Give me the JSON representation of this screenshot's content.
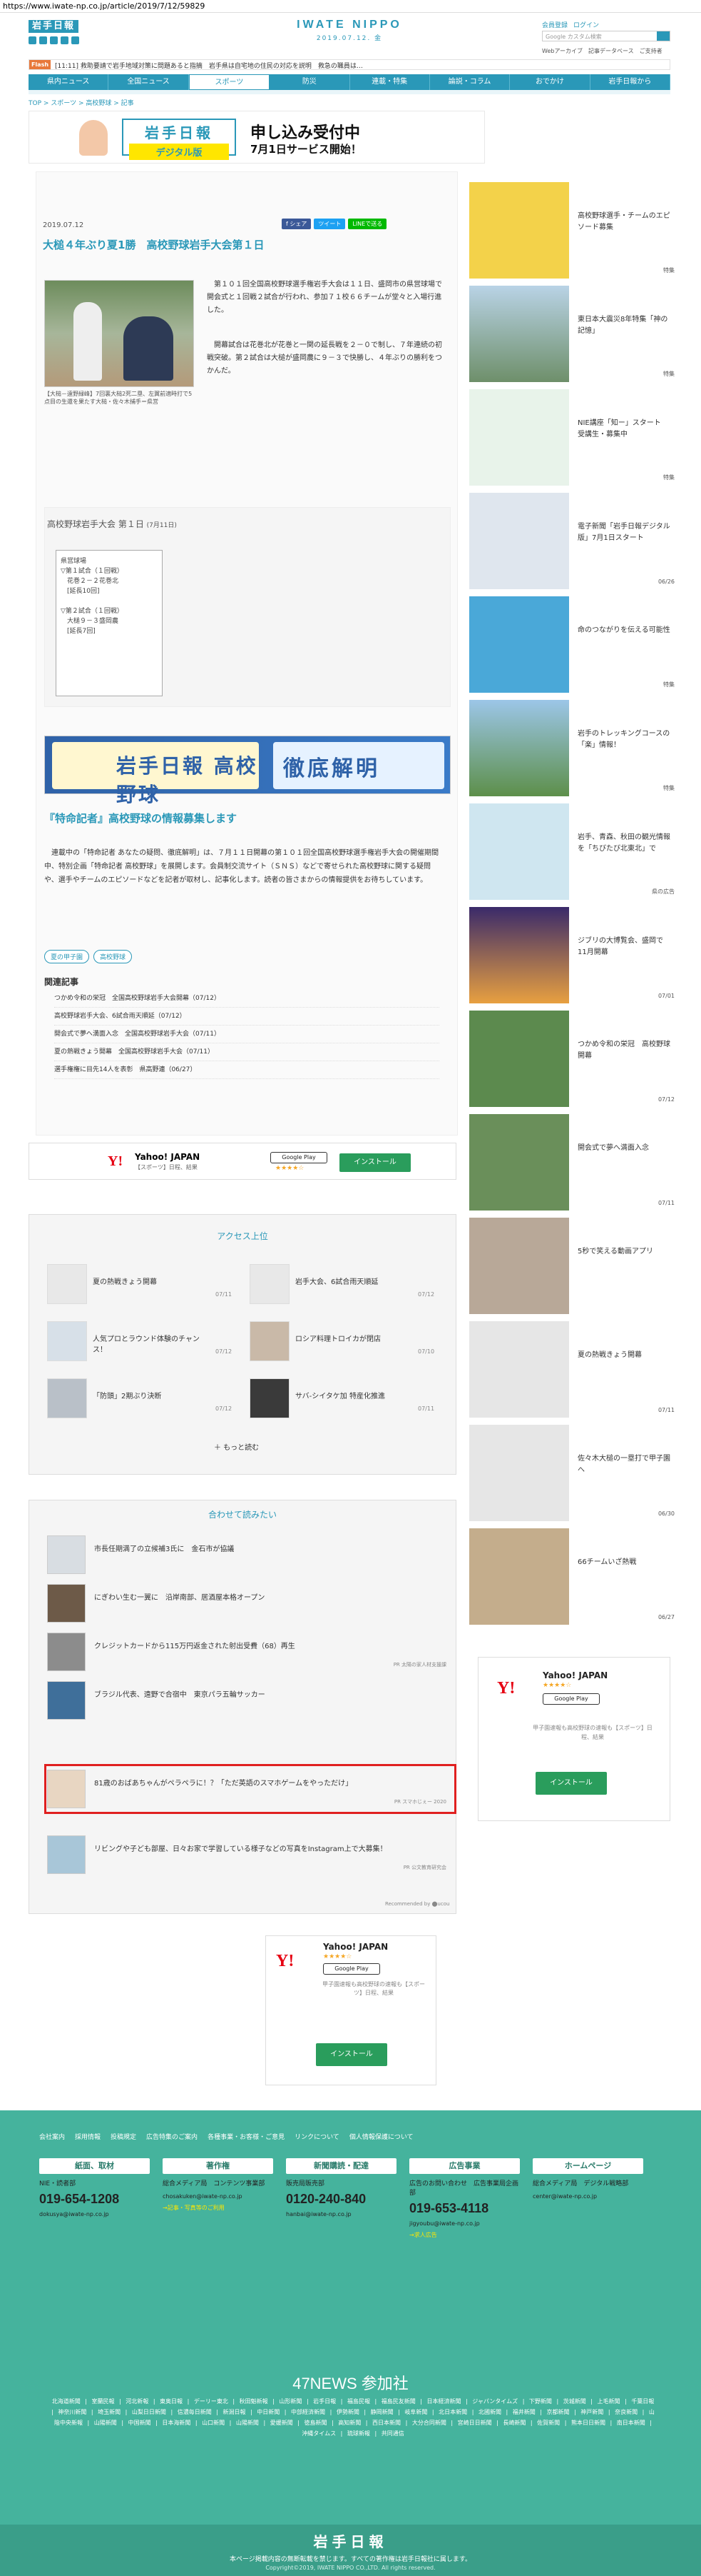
{
  "url": "https://www.iwate-np.co.jp/article/2019/7/12/59829",
  "header": {
    "logo": "岩手日報",
    "brand": "IWATE NIPPO",
    "date": "2019.07.12. 金",
    "toplinks": [
      "会員登録",
      "ログイン"
    ],
    "search_placeholder": "Google カスタム検索",
    "sublinks": [
      "Webアーカイブ",
      "記事データベース",
      "ご支持者"
    ]
  },
  "flash": {
    "tag": "Flash",
    "text": "[11:11] 救助要請で岩手地域対策に問題あると指摘　岩手県は自宅地の住民の対応を説明　救急の職員は…"
  },
  "nav": [
    "県内ニュース",
    "全国ニュース",
    "スポーツ",
    "防災",
    "連載・特集",
    "論説・コラム",
    "おでかけ",
    "岩手日報から"
  ],
  "breadcrumb": "TOP > スポーツ > 高校野球 > 記事",
  "banner_top": {
    "paper_title": "岩手日報",
    "paper_sub": "デジタル版",
    "msg1": "申し込み受付中",
    "msg2": "7月1日サービス開始！"
  },
  "article": {
    "date": "2019.07.12",
    "share": [
      "f シェア",
      "ツイート",
      "LINEで送る"
    ],
    "title": "大槌４年ぶり夏1勝　高校野球岩手大会第１日",
    "caption": "【大槌－遠野緑峰】7回裏大槌2死二塁、左翼前適時打で5点目の生還を果たす大槌・佐々木捕手＝県営",
    "lead": "第１０１回全国高校野球選手権岩手大会は１１日、盛岡市の県営球場で開会式と１回戦２試合が行われ、参加７１校６６チームが堂々と入場行進した。",
    "lead2": "開幕試合は花巻北が花巻と一関の延長戦を２－０で制し、７年連続の初戦突破。第２試合は大槌が盛岡農に９－３で快勝し、４年ぶりの勝利をつかんだ。",
    "results_title": "高校野球岩手大会 第１日",
    "results_date": "(7月11日)",
    "results_lines": [
      "県営球場",
      "▽第１試合（１回戦）",
      "　花巻２－２花巻北",
      "　[延長10回]",
      "",
      "▽第２試合（１回戦）",
      "　大槌９－３盛岡農",
      "　[延長7回]"
    ],
    "banner2_left": "岩手日報 高校野球",
    "banner2_right": "徹底解明",
    "info_title": "『特命記者』高校野球の情報募集します",
    "info_body": "連載中の「特命記者 あなたの疑問、徹底解明」は、７月１１日開幕の第１０１回全国高校野球選手権岩手大会の開催期間中、特別企画「特命記者 高校野球」を展開します。会員制交流サイト（ＳＮＳ）などで寄せられた高校野球に関する疑問や、選手やチームのエピソードなどを記者が取材し、記事化します。読者の皆さまからの情報提供をお待ちしています。",
    "tags": [
      "夏の甲子園",
      "高校野球"
    ],
    "related_head": "関連記事",
    "related": [
      "つかめ令和の栄冠　全国高校野球岩手大会開幕（07/12）",
      "高校野球岩手大会、6試合雨天順延（07/12）",
      "開会式で夢へ満面入念　全国高校野球岩手大会（07/11）",
      "夏の熱戦きょう開幕　全国高校野球岩手大会（07/11）",
      "選手権権に目先14人を表彰　県高野連（06/27）"
    ]
  },
  "ads": {
    "yahoo_name": "Yahoo! JAPAN",
    "yahoo_sub": "【スポーツ】日程、結果",
    "google_play": "Google Play",
    "stars": "★★★★☆",
    "install": "インストール",
    "desc": "甲子園速報も高校野球の速報も【スポーツ】日程、結果"
  },
  "ranking": {
    "head": "アクセス上位",
    "items": [
      {
        "title": "夏の熱戦きょう開幕",
        "date": "07/11"
      },
      {
        "title": "岩手大会、6試合雨天順延",
        "date": "07/12"
      },
      {
        "title": "人気プロとラウンド体験のチャンス！",
        "date": "07/12"
      },
      {
        "title": "ロシア料理トロイカが閉店",
        "date": "07/10"
      },
      {
        "title": "「防頭」2期ぶり決断",
        "date": "07/12"
      },
      {
        "title": "サバ-シイタケ加 特産化推進",
        "date": "07/11"
      }
    ],
    "more": "＋ もっと読む"
  },
  "recommend": {
    "head": "合わせて読みたい",
    "items": [
      {
        "title": "市長任期満了の立候補3氏に　金石市が協議",
        "pr": ""
      },
      {
        "title": "にぎわい生む一翼に　沿岸南部、居酒屋本格オープン",
        "pr": ""
      },
      {
        "title": "クレジットカードから115万円返金された射出受費（68）再生",
        "pr": "PR 太陽の家人材支援課"
      },
      {
        "title": "ブラジル代表、遠野で合宿中　東京パラ五輪サッカー",
        "pr": ""
      },
      {
        "title": "81歳のおばあちゃんがペラペラに！？「ただ英語のスマホゲームをやっただけ」",
        "pr": "PR スマホじぇー 2020"
      },
      {
        "title": "リビングや子ども部屋、日々お家で学習している様子などの写真をInstagram上で大募集！",
        "pr": "PR 公文教育研究会"
      }
    ],
    "recommended_by": "Recommended by ⬤ucou"
  },
  "sidebar": [
    {
      "title": "高校野球選手・チームのエピソード募集",
      "date": "特集"
    },
    {
      "title": "東日本大震災8年特集「神の記憶」",
      "date": "特集"
    },
    {
      "title": "NIE講座「知ー」スタート　受講生・募集中",
      "date": "特集"
    },
    {
      "title": "電子新聞「岩手日報デジタル版」7月1日スタート",
      "date": "06/26"
    },
    {
      "title": "命のつながりを伝える可能性",
      "date": "特集"
    },
    {
      "title": "岩手のトレッキングコースの「楽」情報！",
      "date": "特集"
    },
    {
      "title": "岩手、青森、秋田の観光情報を「ちびたび北東北」で",
      "date": "県の広告"
    },
    {
      "title": "ジブリの大博覧会、盛岡で11月開幕",
      "date": "07/01"
    },
    {
      "title": "つかめ令和の栄冠　高校野球開幕",
      "date": "07/12"
    },
    {
      "title": "開会式で夢へ満面入念",
      "date": "07/11"
    },
    {
      "title": "5秒で笑える動画アプリ",
      "date": ""
    },
    {
      "title": "夏の熱戦きょう開幕",
      "date": "07/11"
    },
    {
      "title": "佐々木大槌の一塁打で甲子園へ",
      "date": "06/30"
    },
    {
      "title": "66チームいざ熱戦",
      "date": "06/27"
    }
  ],
  "footer": {
    "links": [
      "会社案内",
      "採用情報",
      "投稿規定",
      "広告特集のご案内",
      "各種事業・お客様・ご意見",
      "リンクについて",
      "個人情報保護について"
    ],
    "cols": [
      {
        "head": "紙面、取材",
        "sub": "NIE・読者部",
        "tel": "019-654-1208",
        "mail": "dokusya@iwate-np.co.jp",
        "note": ""
      },
      {
        "head": "著作権",
        "sub": "総合メディア局　コンテンツ事業部",
        "tel": "",
        "mail": "chosakuken@iwate-np.co.jp",
        "note": "→記事・写真等のご利用"
      },
      {
        "head": "新聞購読・配達",
        "sub": "販売局販売部",
        "tel": "0120-240-840",
        "mail": "hanbai@iwate-np.co.jp",
        "note": ""
      },
      {
        "head": "広告事業",
        "sub": "広告のお問い合わせ　広告事業局企画部",
        "tel": "019-653-4118",
        "mail": "jigyoubu@iwate-np.co.jp",
        "note": "→求人広告"
      },
      {
        "head": "ホームページ",
        "sub": "総合メディア局　デジタル戦略部",
        "tel": "",
        "mail": "center@iwate-np.co.jp",
        "note": ""
      }
    ],
    "news47": "47NEWS 参加社",
    "partners": "北海道新聞 | 室蘭民報 | 河北新報 | 東奥日報 | デーリー東北 | 秋田魁新報 | 山形新聞 | 岩手日報 | 福島民報 | 福島民友新聞 | 日本経済新聞 | ジャパンタイムズ | 下野新聞 | 茨城新聞 | 上毛新聞 | 千葉日報 | 神奈川新聞 | 埼玉新聞 | 山梨日日新聞 | 信濃毎日新聞 | 新潟日報 | 中日新聞 | 中部経済新聞 | 伊勢新聞 | 静岡新聞 | 岐阜新聞 | 北日本新聞 | 北國新聞 | 福井新聞 | 京都新聞 | 神戸新聞 | 奈良新聞 | 山陰中央新報 | 山陽新聞 | 中国新聞 | 日本海新聞 | 山口新聞 | 山陽新聞 | 愛媛新聞 | 徳島新聞 | 高知新聞 | 西日本新聞 | 大分合同新聞 | 宮崎日日新聞 | 長崎新聞 | 佐賀新聞 | 熊本日日新聞 | 南日本新聞 | 沖縄タイムス | 琉球新報 | 共同通信",
    "logo": "岩手日報",
    "notice": "本ページ掲載内容の無断転載を禁じます。すべての著作権は岩手日報社に属します。",
    "copyright": "Copyright©2019, IWATE NIPPO CO.,LTD. All rights reserved."
  }
}
